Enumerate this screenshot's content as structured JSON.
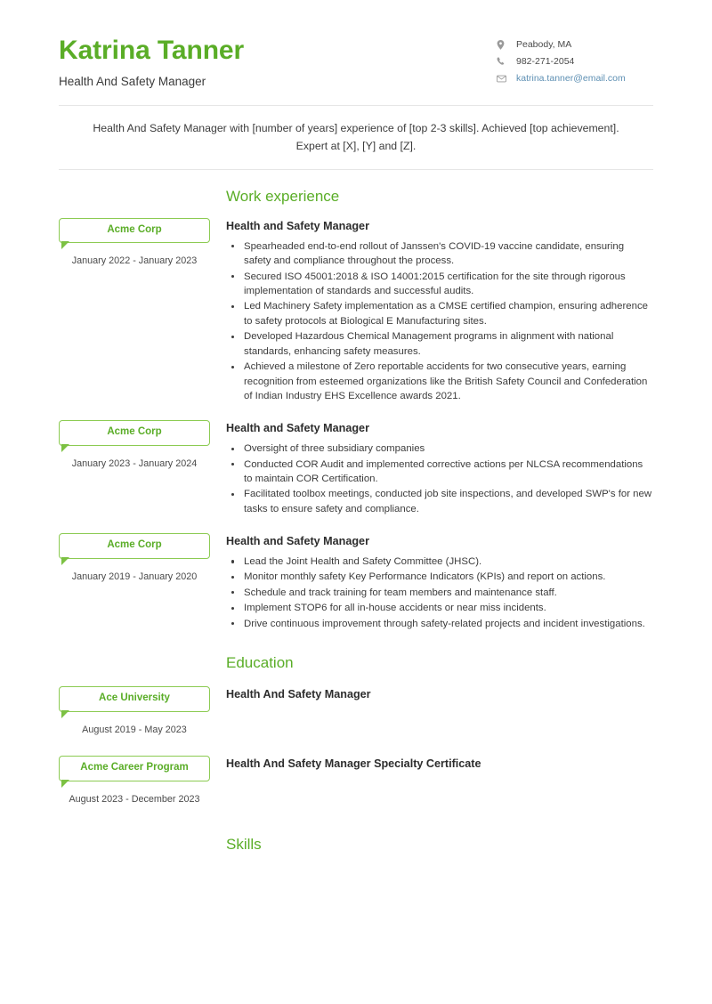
{
  "header": {
    "full_name": "Katrina Tanner",
    "job_headline": "Health And Safety Manager",
    "contacts": [
      {
        "icon": "location-pin-icon",
        "text": "Peabody, MA",
        "type": "plain"
      },
      {
        "icon": "phone-icon",
        "text": "982-271-2054",
        "type": "plain"
      },
      {
        "icon": "envelope-icon",
        "text": "katrina.tanner@email.com",
        "type": "link"
      }
    ]
  },
  "summary": {
    "text": "Health And Safety Manager with [number of years] experience of [top 2-3 skills]. Achieved [top achievement]. Expert at [X], [Y] and [Z]."
  },
  "sections": {
    "work": {
      "title": "Work experience",
      "entries": [
        {
          "company": "Acme Corp",
          "dates": "January 2022 - January 2023",
          "role": "Health and Safety Manager",
          "bullets": [
            "Spearheaded end-to-end rollout of Janssen's COVID-19 vaccine candidate, ensuring safety and compliance throughout the process.",
            "Secured ISO 45001:2018 & ISO 14001:2015 certification for the site through rigorous implementation of standards and successful audits.",
            "Led Machinery Safety implementation as a CMSE certified champion, ensuring adherence to safety protocols at Biological E Manufacturing sites.",
            "Developed Hazardous Chemical Management programs in alignment with national standards, enhancing safety measures.",
            "Achieved a milestone of Zero reportable accidents for two consecutive years, earning recognition from esteemed organizations like the British Safety Council and Confederation of Indian Industry EHS Excellence awards 2021."
          ]
        },
        {
          "company": "Acme Corp",
          "dates": "January 2023 - January 2024",
          "role": "Health and Safety Manager",
          "bullets": [
            "Oversight of three subsidiary companies",
            "Conducted COR Audit and implemented corrective actions per NLCSA recommendations to maintain COR Certification.",
            "Facilitated toolbox meetings, conducted job site inspections, and developed SWP's for new tasks to ensure safety and compliance."
          ]
        },
        {
          "company": "Acme Corp",
          "dates": "January 2019 - January 2020",
          "role": "Health and Safety Manager",
          "bullets": [
            "Lead the Joint Health and Safety Committee (JHSC).",
            "Monitor monthly safety Key Performance Indicators (KPIs) and report on actions.",
            "Schedule and track training for team members and maintenance staff.",
            "Implement STOP6 for all in-house accidents or near miss incidents.",
            "Drive continuous improvement through safety-related projects and incident investigations."
          ]
        }
      ]
    },
    "education": {
      "title": "Education",
      "entries": [
        {
          "institution": "Ace University",
          "dates": "August 2019 - May 2023",
          "degree": "Health And Safety Manager"
        },
        {
          "institution": "Acme Career Program",
          "dates": "August 2023 - December 2023",
          "degree": "Health And Safety Manager Specialty Certificate"
        }
      ]
    },
    "skills": {
      "title": "Skills",
      "items": []
    }
  },
  "colors": {
    "accent_green": "#5aad27",
    "chip_border": "#8ccb52",
    "link_blue": "#5d8fb3",
    "body_text": "#3c3c3c",
    "divider": "#e6e6e6"
  }
}
